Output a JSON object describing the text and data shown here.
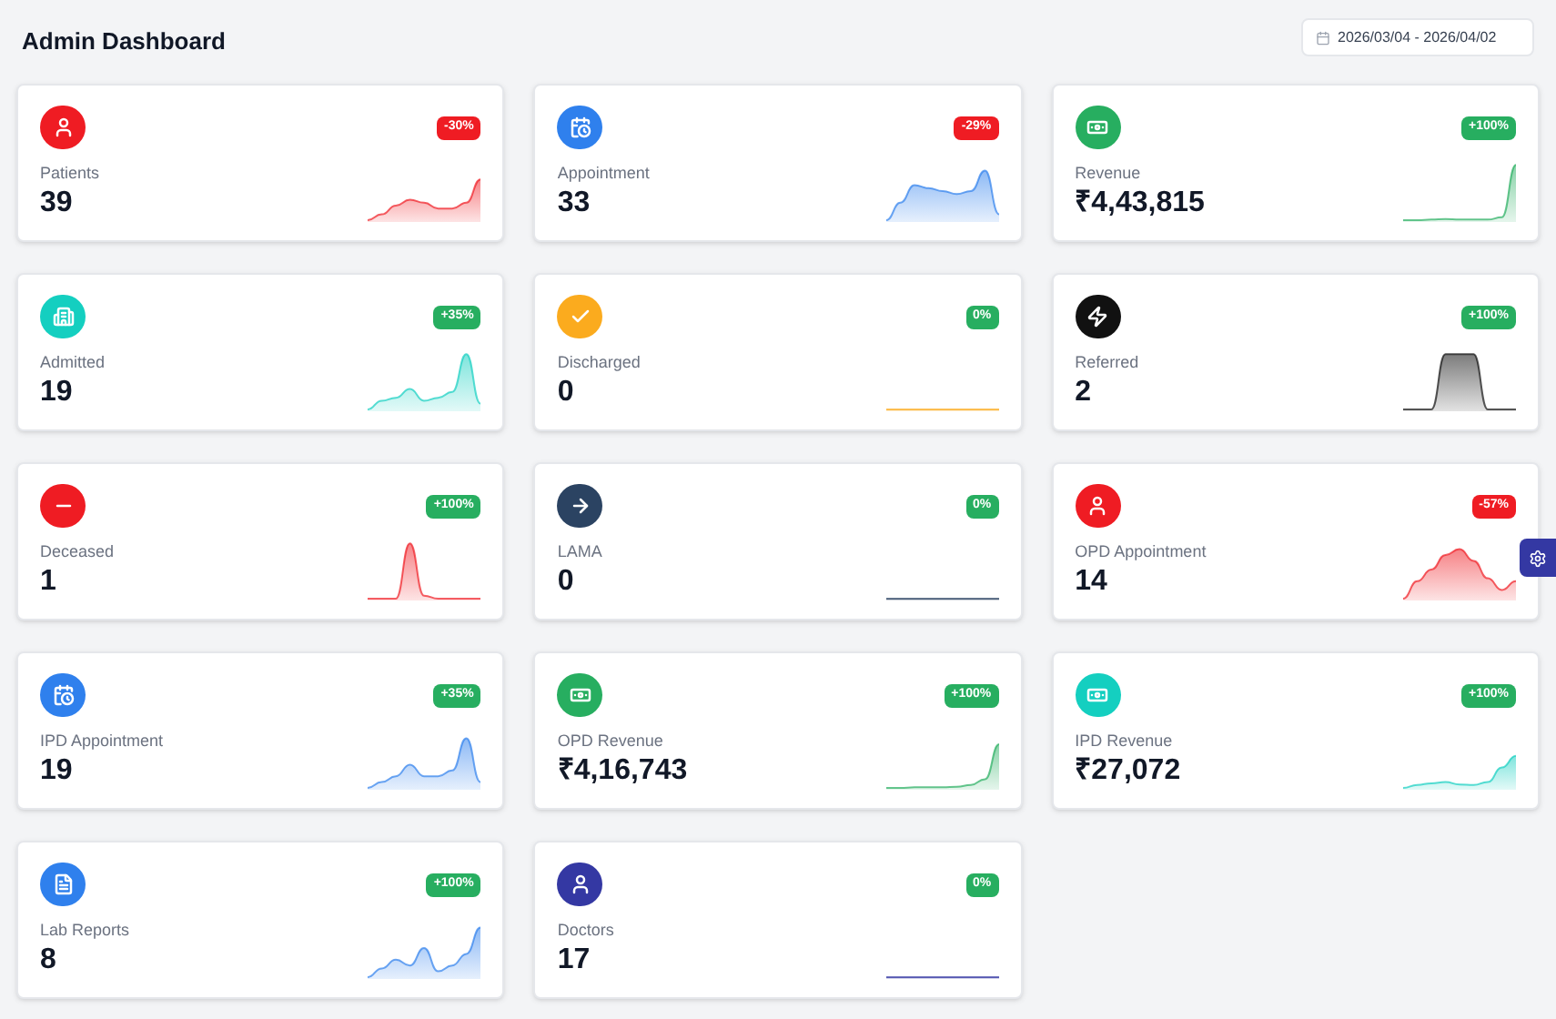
{
  "header": {
    "title": "Admin Dashboard",
    "date_range": "2026/03/04 - 2026/04/02"
  },
  "cards": [
    {
      "label": "Patients",
      "value": "39",
      "badge": {
        "text": "-30%",
        "color": "#ef1c23"
      },
      "color": "#ef1c23"
    },
    {
      "label": "Appointment",
      "value": "33",
      "badge": {
        "text": "-29%",
        "color": "#ef1c23"
      },
      "color": "#2f80ed"
    },
    {
      "label": "Revenue",
      "value": "₹4,43,815",
      "badge": {
        "text": "+100%",
        "color": "#27ae60"
      },
      "color": "#27ae60"
    },
    {
      "label": "Admitted",
      "value": "19",
      "badge": {
        "text": "+35%",
        "color": "#27ae60"
      },
      "color": "#14cfc0"
    },
    {
      "label": "Discharged",
      "value": "0",
      "badge": {
        "text": "0%",
        "color": "#27ae60"
      },
      "color": "#fbab1e"
    },
    {
      "label": "Referred",
      "value": "2",
      "badge": {
        "text": "+100%",
        "color": "#27ae60"
      },
      "color": "#111111"
    },
    {
      "label": "Deceased",
      "value": "1",
      "badge": {
        "text": "+100%",
        "color": "#27ae60"
      },
      "color": "#ef1c23"
    },
    {
      "label": "LAMA",
      "value": "0",
      "badge": {
        "text": "0%",
        "color": "#27ae60"
      },
      "color": "#2b4362"
    },
    {
      "label": "OPD Appointment",
      "value": "14",
      "badge": {
        "text": "-57%",
        "color": "#ef1c23"
      },
      "color": "#ef1c23"
    },
    {
      "label": "IPD Appointment",
      "value": "19",
      "badge": {
        "text": "+35%",
        "color": "#27ae60"
      },
      "color": "#2f80ed"
    },
    {
      "label": "OPD Revenue",
      "value": "₹4,16,743",
      "badge": {
        "text": "+100%",
        "color": "#27ae60"
      },
      "color": "#27ae60"
    },
    {
      "label": "IPD Revenue",
      "value": "₹27,072",
      "badge": {
        "text": "+100%",
        "color": "#27ae60"
      },
      "color": "#14cfc0"
    },
    {
      "label": "Lab Reports",
      "value": "8",
      "badge": {
        "text": "+100%",
        "color": "#27ae60"
      },
      "color": "#2f80ed"
    },
    {
      "label": "Doctors",
      "value": "17",
      "badge": {
        "text": "0%",
        "color": "#27ae60"
      },
      "color": "#3438a3"
    }
  ]
}
